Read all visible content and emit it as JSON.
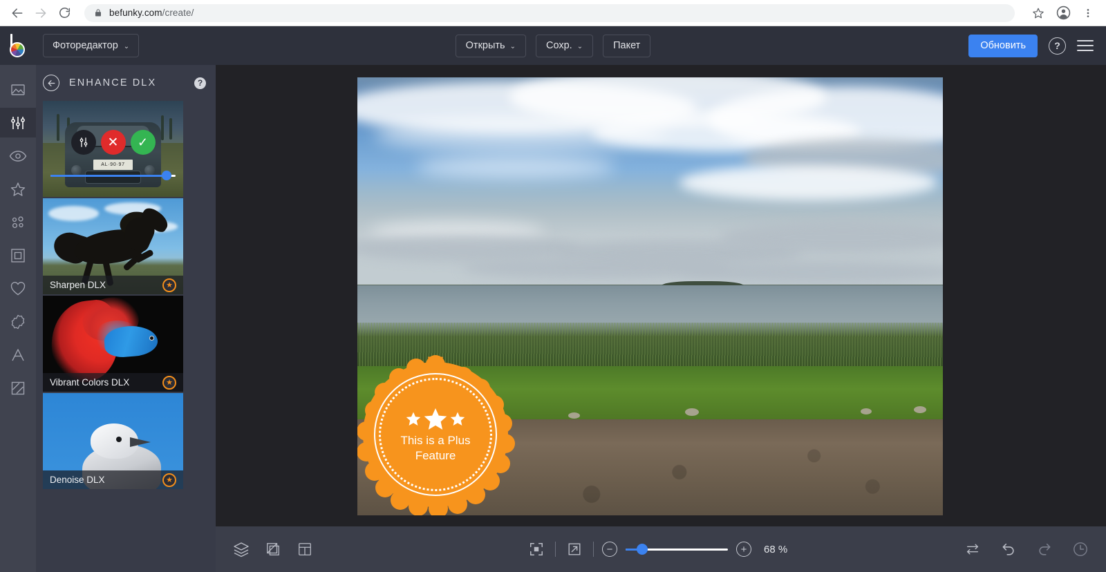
{
  "browser": {
    "back_icon": "back-arrow-icon",
    "forward_icon": "forward-arrow-icon",
    "reload_icon": "reload-icon",
    "lock_icon": "lock-icon",
    "url_domain": "befunky.com",
    "url_path": "/create/",
    "bookmark_icon": "star-outline-icon",
    "profile_icon": "account-avatar-icon",
    "menu_icon": "three-dots-menu-icon"
  },
  "app_header": {
    "logo": "befunky-logo-icon",
    "mode_label": "Фоторедактор",
    "caret": "⌄",
    "buttons": [
      {
        "label": "Открыть",
        "has_caret": true,
        "name": "open-button"
      },
      {
        "label": "Сохр.",
        "has_caret": true,
        "name": "save-button"
      },
      {
        "label": "Пакет",
        "has_caret": false,
        "name": "batch-button"
      }
    ],
    "upgrade_label": "Обновить",
    "help_label": "?",
    "menu_icon": "hamburger-menu-icon"
  },
  "icon_rail": {
    "items": [
      {
        "name": "sidebar-item-image",
        "icon": "image-mountain-icon",
        "active": false
      },
      {
        "name": "sidebar-item-edit",
        "icon": "sliders-adjust-icon",
        "active": true
      },
      {
        "name": "sidebar-item-touch-up",
        "icon": "eye-icon",
        "active": false
      },
      {
        "name": "sidebar-item-effects",
        "icon": "star-outline-icon",
        "active": false
      },
      {
        "name": "sidebar-item-artsy",
        "icon": "four-dots-icon",
        "active": false
      },
      {
        "name": "sidebar-item-frames",
        "icon": "frame-square-icon",
        "active": false
      },
      {
        "name": "sidebar-item-graphics",
        "icon": "heart-icon",
        "active": false
      },
      {
        "name": "sidebar-item-overlays",
        "icon": "starburst-badge-icon",
        "active": false
      },
      {
        "name": "sidebar-item-text",
        "icon": "letter-a-icon",
        "active": false
      },
      {
        "name": "sidebar-item-textures",
        "icon": "diagonal-lines-square-icon",
        "active": false
      }
    ]
  },
  "panel": {
    "back_icon": "back-circle-arrow-icon",
    "title": "ENHANCE DLX",
    "help_label": "?",
    "items": [
      {
        "name": "thumb-enhance-dlx",
        "label": "",
        "active": true,
        "plus": false,
        "controls": {
          "settings_icon": "sliders-icon",
          "reject_icon": "✕",
          "accept_icon": "✓",
          "slider_value": 89
        },
        "plate_text": "AL·90·97"
      },
      {
        "name": "thumb-sharpen-dlx",
        "label": "Sharpen DLX",
        "plus": true,
        "plus_icon": "★"
      },
      {
        "name": "thumb-vibrant-colors-dlx",
        "label": "Vibrant Colors DLX",
        "plus": true,
        "plus_icon": "★"
      },
      {
        "name": "thumb-denoise-dlx",
        "label": "Denoise DLX",
        "plus": true,
        "plus_icon": "★"
      }
    ]
  },
  "canvas": {
    "plus_seal": {
      "stars": "★★★",
      "line1": "This is a Plus",
      "line2": "Feature"
    }
  },
  "bottom_bar": {
    "left_icons": [
      {
        "name": "layers-icon",
        "glyph": "layers"
      },
      {
        "name": "crop-rotate-icon",
        "glyph": "crop"
      },
      {
        "name": "collage-layout-icon",
        "glyph": "layout"
      }
    ],
    "fit_icon": "fit-to-screen-icon",
    "expand_icon": "fullscreen-expand-icon",
    "zoom_out_label": "−",
    "zoom_in_label": "+",
    "zoom_value": "68 %",
    "zoom_slider_percent": 13,
    "right_icons": [
      {
        "name": "compare-swap-icon",
        "dim": false
      },
      {
        "name": "undo-icon",
        "dim": false
      },
      {
        "name": "redo-icon",
        "dim": true
      },
      {
        "name": "history-clock-icon",
        "dim": true
      }
    ]
  },
  "colors": {
    "accent_blue": "#3b82f0",
    "plus_orange": "#f7941d",
    "header_bg": "#2e313c",
    "panel_bg": "#383b48",
    "rail_bg": "#40434f",
    "canvas_bg": "#222226",
    "bottom_bar_bg": "#3b3e4a",
    "accept_green": "#34b552",
    "reject_red": "#e02b2b"
  }
}
